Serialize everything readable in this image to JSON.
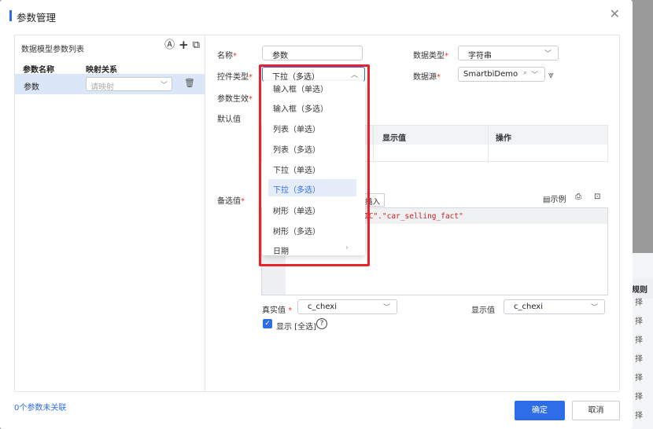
{
  "dialog": {
    "title": "参数管理",
    "close_icon": "close-icon"
  },
  "left_panel": {
    "title": "数据模型参数列表",
    "col_name": "参数名称",
    "col_mapping": "映射关系",
    "row": {
      "name": "参数",
      "mapping_placeholder": "请映射"
    },
    "footer": "0个参数未关联"
  },
  "form": {
    "name_label": "名称",
    "name_value": "参数",
    "control_type_label": "控件类型",
    "control_type_value": "下拉（多选）",
    "data_type_label": "数据类型",
    "data_type_value": "字符串",
    "data_source_label": "数据源",
    "data_source_value": "SmartbiDemo",
    "param_effect_label": "参数生效",
    "default_label": "默认值",
    "default_table": {
      "col_display": "显示值",
      "col_action": "操作"
    },
    "options_label": "备选值",
    "insert_btn": "插入",
    "example": "示例",
    "code": "IC\".\"car_selling_fact\"",
    "real_value_label": "真实值",
    "real_value": "c_chexi",
    "display_value_label": "显示值",
    "display_value": "c_chexi",
    "show_all": "显示 [全选]"
  },
  "dropdown": {
    "items": [
      "输入框（单选）",
      "输入框（多选）",
      "列表（单选）",
      "列表（多选）",
      "下拉（单选）",
      "下拉（多选）",
      "树形（单选）",
      "树形（多选）",
      "日期"
    ],
    "active_index": 5
  },
  "buttons": {
    "ok": "确定",
    "cancel": "取消"
  },
  "backdrop": {
    "header": "规则",
    "items": [
      "择",
      "择",
      "择",
      "择",
      "择",
      "择",
      "择"
    ]
  },
  "colors": {
    "accent": "#2e6de8",
    "highlight": "#e8242a"
  }
}
